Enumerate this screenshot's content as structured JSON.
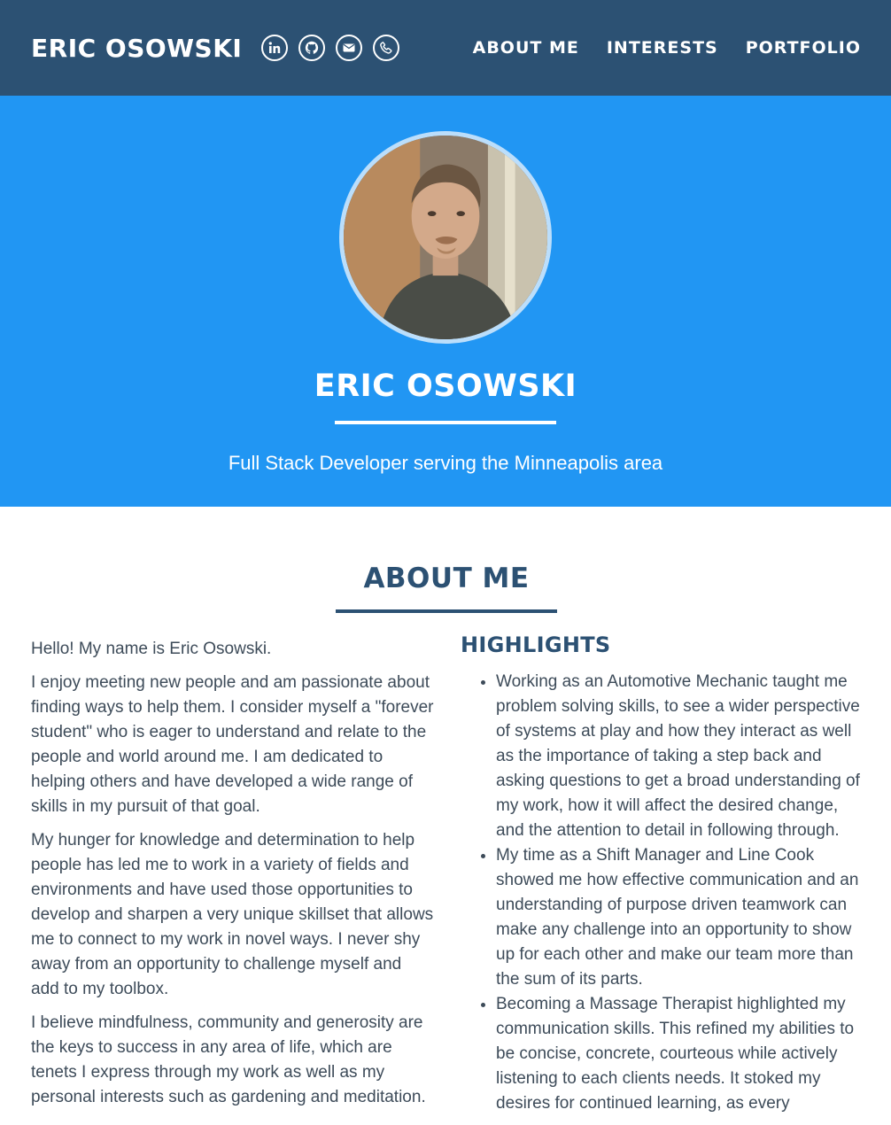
{
  "nav": {
    "brand": "ERIC OSOWSKI",
    "social": [
      {
        "icon": "linkedin-icon",
        "label": "in"
      },
      {
        "icon": "github-icon"
      },
      {
        "icon": "envelope-icon"
      },
      {
        "icon": "phone-icon"
      }
    ],
    "links": [
      "ABOUT ME",
      "INTERESTS",
      "PORTFOLIO"
    ]
  },
  "hero": {
    "name": "ERIC OSOWSKI",
    "subtitle": "Full Stack Developer serving the Minneapolis area",
    "avatar_icon": "profile-photo",
    "bg_color": "#2196f3"
  },
  "about": {
    "title": "ABOUT ME",
    "paragraphs": [
      "Hello! My name is Eric Osowski.",
      "I enjoy meeting new people and am passionate about finding ways to help them. I consider myself a \"forever student\" who is eager to understand and relate to the people and world around me. I am dedicated to helping others and have developed a wide range of skills in my pursuit of that goal.",
      "My hunger for knowledge and determination to help people has led me to work in a variety of fields and environments and have used those opportunities to develop and sharpen a very unique skillset that allows me to connect to my work in novel ways. I never shy away from an opportunity to challenge myself and add to my toolbox.",
      "I believe mindfulness, community and generosity are the keys to success in any area of life, which are tenets I express through my work as well as my personal interests such as gardening and meditation."
    ],
    "highlights_title": "HIGHLIGHTS",
    "highlights": [
      "Working as an Automotive Mechanic taught me problem solving skills, to see a wider perspective of systems at play and how they interact as well as the importance of taking a step back and asking questions to get a broad understanding of my work, how it will affect the desired change, and the attention to detail in following through.",
      "My time as a Shift Manager and Line Cook showed me how effective communication and an understanding of purpose driven teamwork can make any challenge into an opportunity to show up for each other and make our team more than the sum of its parts.",
      "Becoming a Massage Therapist highlighted my communication skills. This refined my abilities to be concise, concrete, courteous while actively listening to each clients needs. It stoked my desires for continued learning, as every"
    ]
  }
}
